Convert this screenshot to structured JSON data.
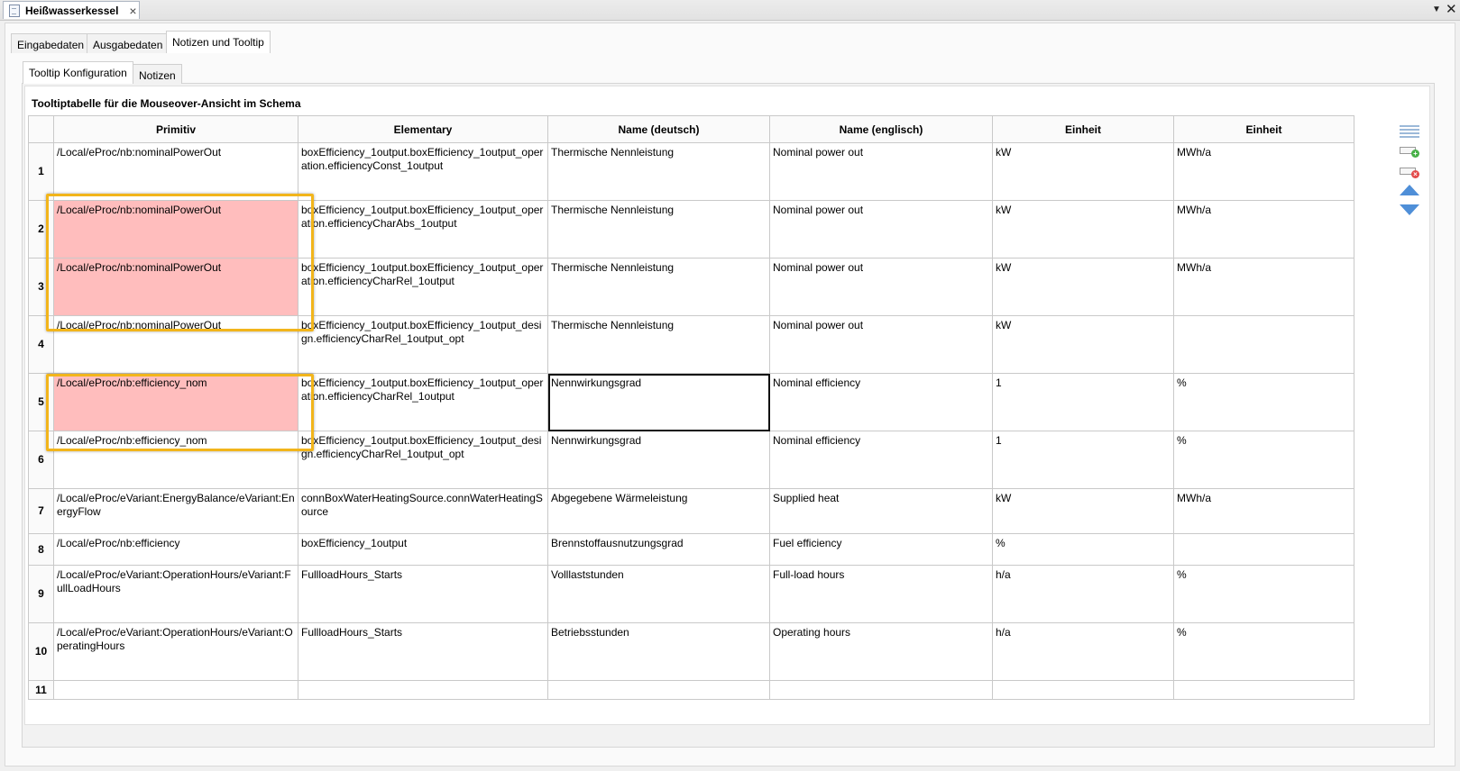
{
  "editor_tab": {
    "title": "Heißwasserkessel",
    "close_glyph": "×"
  },
  "window": {
    "menu_glyph": "▼",
    "close_glyph": "✕"
  },
  "main_tabs": [
    "Eingabedaten",
    "Ausgabedaten",
    "Notizen und Tooltip"
  ],
  "sub_tabs": [
    "Tooltip Konfiguration",
    "Notizen"
  ],
  "table_title": "Tooltiptabelle für die Mouseover-Ansicht im Schema",
  "columns": [
    "Primitiv",
    "Elementary",
    "Name (deutsch)",
    "Name (englisch)",
    "Einheit",
    "Einheit"
  ],
  "rows": [
    {
      "num": "1",
      "primitiv": "/Local/eProc/nb:nominalPowerOut",
      "elementary": "boxEfficiency_1output.boxEfficiency_1output_operation.efficiencyConst_1output",
      "name_de": "Thermische Nennleistung",
      "name_en": "Nominal power out",
      "unit1": "kW",
      "unit2": "MWh/a"
    },
    {
      "num": "2",
      "primitiv": "/Local/eProc/nb:nominalPowerOut",
      "elementary": "boxEfficiency_1output.boxEfficiency_1output_operation.efficiencyCharAbs_1output",
      "name_de": "Thermische Nennleistung",
      "name_en": "Nominal power out",
      "unit1": "kW",
      "unit2": "MWh/a"
    },
    {
      "num": "3",
      "primitiv": "/Local/eProc/nb:nominalPowerOut",
      "elementary": "boxEfficiency_1output.boxEfficiency_1output_operation.efficiencyCharRel_1output",
      "name_de": "Thermische Nennleistung",
      "name_en": "Nominal power out",
      "unit1": "kW",
      "unit2": "MWh/a"
    },
    {
      "num": "4",
      "primitiv": "/Local/eProc/nb:nominalPowerOut",
      "elementary": "boxEfficiency_1output.boxEfficiency_1output_design.efficiencyCharRel_1output_opt",
      "name_de": "Thermische Nennleistung",
      "name_en": "Nominal power out",
      "unit1": "kW",
      "unit2": ""
    },
    {
      "num": "5",
      "primitiv": "/Local/eProc/nb:efficiency_nom",
      "elementary": "boxEfficiency_1output.boxEfficiency_1output_operation.efficiencyCharRel_1output",
      "name_de": "Nennwirkungsgrad",
      "name_en": "Nominal efficiency",
      "unit1": "1",
      "unit2": "%"
    },
    {
      "num": "6",
      "primitiv": "/Local/eProc/nb:efficiency_nom",
      "elementary": "boxEfficiency_1output.boxEfficiency_1output_design.efficiencyCharRel_1output_opt",
      "name_de": "Nennwirkungsgrad",
      "name_en": "Nominal efficiency",
      "unit1": "1",
      "unit2": "%"
    },
    {
      "num": "7",
      "primitiv": "/Local/eProc/eVariant:EnergyBalance/eVariant:EnergyFlow",
      "elementary": "connBoxWaterHeatingSource.connWaterHeatingSource",
      "name_de": "Abgegebene Wärmeleistung",
      "name_en": "Supplied heat",
      "unit1": "kW",
      "unit2": "MWh/a"
    },
    {
      "num": "8",
      "primitiv": "/Local/eProc/nb:efficiency",
      "elementary": "boxEfficiency_1output",
      "name_de": "Brennstoffausnutzungsgrad",
      "name_en": "Fuel efficiency",
      "unit1": "%",
      "unit2": ""
    },
    {
      "num": "9",
      "primitiv": "/Local/eProc/eVariant:OperationHours/eVariant:FullLoadHours",
      "elementary": "FullloadHours_Starts",
      "name_de": "Volllaststunden",
      "name_en": "Full-load hours",
      "unit1": "h/a",
      "unit2": "%"
    },
    {
      "num": "10",
      "primitiv": "/Local/eProc/eVariant:OperationHours/eVariant:OperatingHours",
      "elementary": "FullloadHours_Starts",
      "name_de": "Betriebsstunden",
      "name_en": "Operating hours",
      "unit1": "h/a",
      "unit2": "%"
    },
    {
      "num": "11",
      "primitiv": "",
      "elementary": "",
      "name_de": "",
      "name_en": "",
      "unit1": "",
      "unit2": ""
    }
  ],
  "error_cells_rows": [
    2,
    3,
    5
  ],
  "selected_cell": {
    "row": 5,
    "column": "Name (deutsch)"
  },
  "colors": {
    "error_fill": "#ffbdbd",
    "highlight_border": "#f2b51b",
    "arrow_blue": "#4f8fd8"
  },
  "toolbar_icons": [
    "list-icon",
    "add-row-icon",
    "remove-row-icon",
    "move-up-icon",
    "move-down-icon"
  ]
}
